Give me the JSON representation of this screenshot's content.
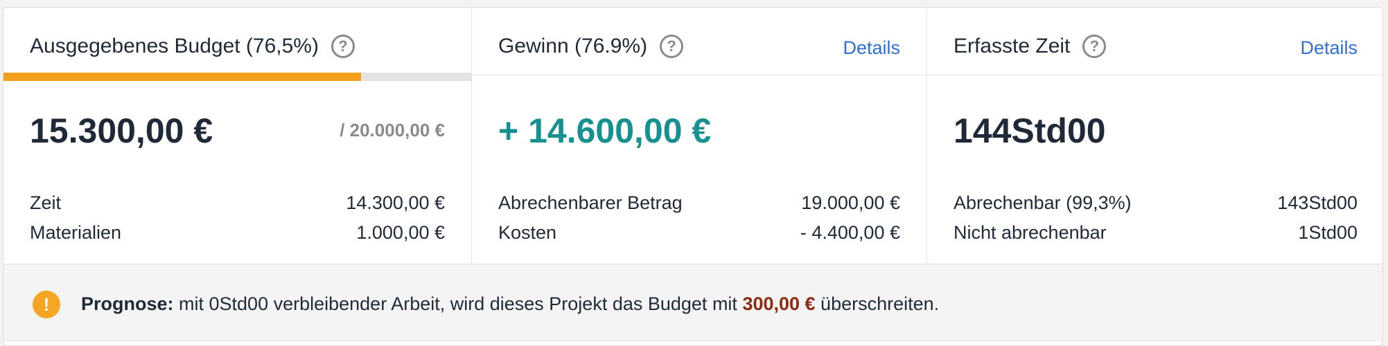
{
  "budget": {
    "title": "Ausgegebenes Budget (76,5%)",
    "help_icon": "?",
    "progress_fraction": 0.765,
    "accent_color": "#f2a01b",
    "spent": "15.300,00 €",
    "total": "/ 20.000,00 €",
    "rows": [
      {
        "label": "Zeit",
        "value": "14.300,00 €"
      },
      {
        "label": "Materialien",
        "value": "1.000,00 €"
      }
    ]
  },
  "profit": {
    "title": "Gewinn (76.9%)",
    "help_icon": "?",
    "details": "Details",
    "amount": "+ 14.600,00 €",
    "amount_color": "#17918f",
    "rows": [
      {
        "label": "Abrechenbarer Betrag",
        "value": "19.000,00 €"
      },
      {
        "label": "Kosten",
        "value": "- 4.400,00 €"
      }
    ]
  },
  "time": {
    "title": "Erfasste Zeit",
    "help_icon": "?",
    "details": "Details",
    "total": "144Std00",
    "rows": [
      {
        "label": "Abrechenbar (99,3%)",
        "value": "143Std00"
      },
      {
        "label": "Nicht abrechenbar",
        "value": "1Std00"
      }
    ]
  },
  "forecast": {
    "icon": "!",
    "label": "Prognose:",
    "text_before": " mit 0Std00 verbleibender Arbeit, wird dieses Projekt das Budget mit ",
    "amount": "300,00 €",
    "text_after": " überschreiten."
  }
}
